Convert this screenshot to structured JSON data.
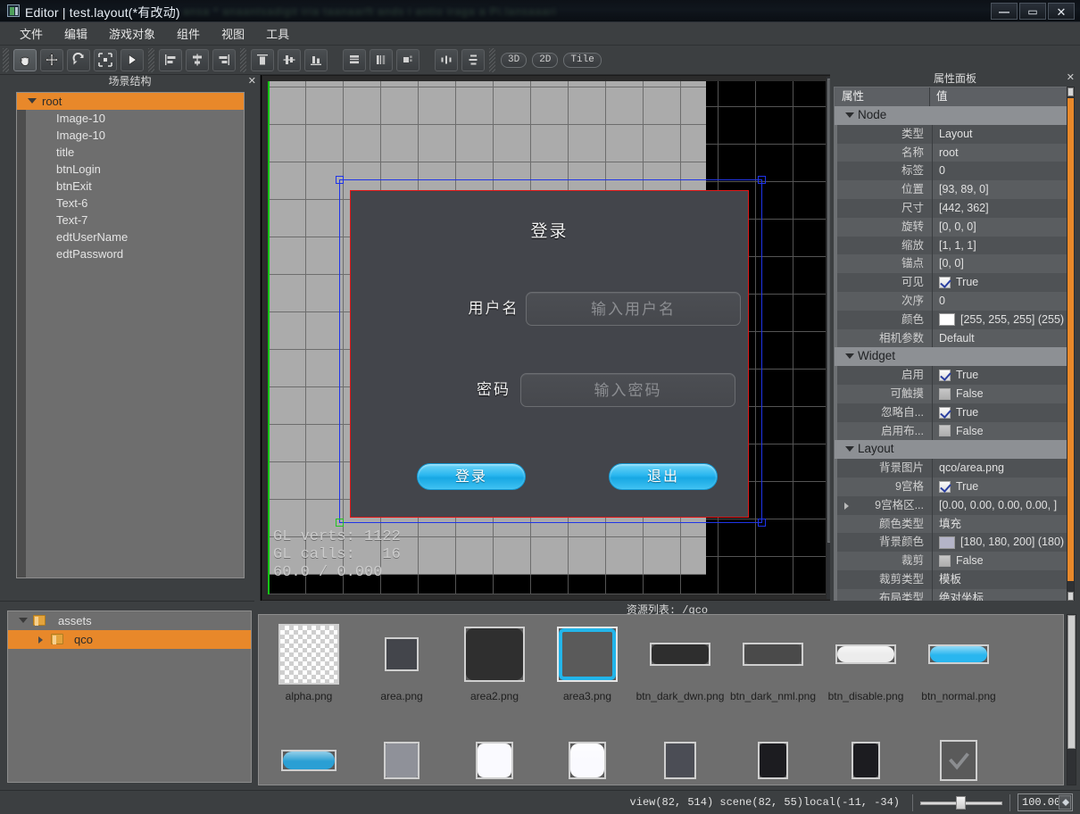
{
  "window": {
    "title": "Editor | test.layout(*有改动)",
    "ghost_title": "ansa  *  anaantsadigit  iria  taanaarft    ands  i  antio  iraga   a   Pi.lansaaari",
    "minimize_label": "—",
    "maximize_label": "▭",
    "close_label": "✕"
  },
  "menubar": {
    "items": [
      {
        "label": "文件"
      },
      {
        "label": "编辑"
      },
      {
        "label": "游戏对象"
      },
      {
        "label": "组件"
      },
      {
        "label": "视图"
      },
      {
        "label": "工具"
      }
    ]
  },
  "toolbar": {
    "tools": [
      {
        "name": "hand-tool",
        "icon": "hand-icon",
        "active": true
      },
      {
        "name": "move-tool",
        "icon": "move-arrows-icon",
        "active": false
      },
      {
        "name": "rotate-tool",
        "icon": "rotate-icon",
        "active": false
      },
      {
        "name": "scale-tool",
        "icon": "scale-icon",
        "active": false
      },
      {
        "name": "play-tool",
        "icon": "play-icon",
        "active": false
      }
    ],
    "align_h": [
      {
        "name": "align-left",
        "icon": "align-left-icon"
      },
      {
        "name": "align-center-h",
        "icon": "align-center-h-icon"
      },
      {
        "name": "align-right",
        "icon": "align-right-icon"
      }
    ],
    "align_v": [
      {
        "name": "align-top",
        "icon": "align-top-icon"
      },
      {
        "name": "align-middle-v",
        "icon": "align-middle-v-icon"
      },
      {
        "name": "align-bottom",
        "icon": "align-bottom-icon"
      }
    ],
    "distribute": [
      {
        "name": "stack-vertical",
        "icon": "stack-vertical-icon"
      },
      {
        "name": "stack-horizontal",
        "icon": "stack-horizontal-icon"
      },
      {
        "name": "size-match",
        "icon": "size-match-icon"
      }
    ],
    "spacing": [
      {
        "name": "distribute-horizontal",
        "icon": "distribute-h-icon"
      },
      {
        "name": "distribute-vertical",
        "icon": "distribute-v-icon"
      }
    ],
    "modes": [
      {
        "label": "3D",
        "name": "mode-3d"
      },
      {
        "label": "2D",
        "name": "mode-2d"
      },
      {
        "label": "Tile",
        "name": "mode-tile"
      }
    ]
  },
  "scene_panel": {
    "title": "场景结构",
    "close_label": "✕",
    "root": {
      "label": "root",
      "selected": true
    },
    "children": [
      {
        "label": "Image-10"
      },
      {
        "label": "Image-10"
      },
      {
        "label": "title"
      },
      {
        "label": "btnLogin"
      },
      {
        "label": "btnExit"
      },
      {
        "label": "Text-6"
      },
      {
        "label": "Text-7"
      },
      {
        "label": "edtUserName"
      },
      {
        "label": "edtPassword"
      }
    ]
  },
  "viewport": {
    "dialog": {
      "title": "登录",
      "fields": [
        {
          "label": "用户名",
          "placeholder": "输入用户名",
          "name": "username"
        },
        {
          "label": "密码",
          "placeholder": "输入密码",
          "name": "password"
        }
      ],
      "buttons": [
        {
          "label": "登录",
          "name": "login"
        },
        {
          "label": "退出",
          "name": "exit"
        }
      ]
    },
    "gl_stats": {
      "verts_label": "GL verts:",
      "verts_value": "1122",
      "calls_label": "GL calls:",
      "calls_value": "16",
      "fps_line": "60.0 / 0.000"
    }
  },
  "properties": {
    "title": "属性面板",
    "close_label": "✕",
    "col_key": "属性",
    "col_value": "值",
    "groups": [
      {
        "name": "Node",
        "rows": [
          {
            "key": "类型",
            "value": "Layout",
            "type": "text"
          },
          {
            "key": "名称",
            "value": "root",
            "type": "text"
          },
          {
            "key": "标签",
            "value": "0",
            "type": "text"
          },
          {
            "key": "位置",
            "value": "[93, 89, 0]",
            "type": "text"
          },
          {
            "key": "尺寸",
            "value": "[442, 362]",
            "type": "text"
          },
          {
            "key": "旋转",
            "value": "[0, 0, 0]",
            "type": "text"
          },
          {
            "key": "缩放",
            "value": "[1, 1, 1]",
            "type": "text"
          },
          {
            "key": "锚点",
            "value": "[0, 0]",
            "type": "text"
          },
          {
            "key": "可见",
            "value": "True",
            "type": "checkbox",
            "checked": true
          },
          {
            "key": "次序",
            "value": "0",
            "type": "text"
          },
          {
            "key": "颜色",
            "value": "[255, 255, 255] (255)",
            "type": "color",
            "color": "#ffffff"
          },
          {
            "key": "相机参数",
            "value": "Default",
            "type": "text"
          }
        ]
      },
      {
        "name": "Widget",
        "rows": [
          {
            "key": "启用",
            "value": "True",
            "type": "checkbox",
            "checked": true
          },
          {
            "key": "可触摸",
            "value": "False",
            "type": "checkbox",
            "checked": false
          },
          {
            "key": "忽略自...",
            "value": "True",
            "type": "checkbox",
            "checked": true
          },
          {
            "key": "启用布...",
            "value": "False",
            "type": "checkbox",
            "checked": false
          }
        ]
      },
      {
        "name": "Layout",
        "rows": [
          {
            "key": "背景图片",
            "value": "qco/area.png",
            "type": "text"
          },
          {
            "key": "9宫格",
            "value": "True",
            "type": "checkbox",
            "checked": true
          },
          {
            "key": "9宫格区...",
            "value": "[0.00, 0.00, 0.00, 0.00, ]",
            "type": "expandable"
          },
          {
            "key": "颜色类型",
            "value": "填充",
            "type": "text"
          },
          {
            "key": "背景颜色",
            "value": "[180, 180, 200] (180)",
            "type": "color",
            "color": "#b4b4c8"
          },
          {
            "key": "裁剪",
            "value": "False",
            "type": "checkbox",
            "checked": false
          },
          {
            "key": "裁剪类型",
            "value": "模板",
            "type": "text"
          },
          {
            "key": "布局类型",
            "value": "绝对坐标",
            "type": "text"
          }
        ]
      }
    ]
  },
  "assets_tree": {
    "root": {
      "label": "assets"
    },
    "children": [
      {
        "label": "qco",
        "selected": true
      }
    ]
  },
  "resources": {
    "title": "资源列表: /qco",
    "items": [
      {
        "name": "alpha.png",
        "thumb": "checker",
        "w": 68,
        "h": 68,
        "color": "#ffffff",
        "radius": 0,
        "selected": false
      },
      {
        "name": "area.png",
        "thumb": "solid",
        "w": 38,
        "h": 38,
        "color": "#43454b",
        "radius": 0,
        "selected": false
      },
      {
        "name": "area2.png",
        "thumb": "solid",
        "w": 68,
        "h": 62,
        "color": "#2f2f2f",
        "radius": 8,
        "selected": false
      },
      {
        "name": "area3.png",
        "thumb": "outline",
        "w": 68,
        "h": 62,
        "color": "#22b5ea",
        "radius": 6,
        "selected": true
      },
      {
        "name": "btn_dark_dwn.png",
        "thumb": "solid",
        "w": 68,
        "h": 26,
        "color": "#2e2e2e",
        "radius": 6,
        "selected": false
      },
      {
        "name": "btn_dark_nml.png",
        "thumb": "solid",
        "w": 68,
        "h": 26,
        "color": "#4a4a4a",
        "radius": 6,
        "selected": false
      },
      {
        "name": "btn_disable.png",
        "thumb": "solid",
        "w": 68,
        "h": 22,
        "color": "#ececec",
        "radius": 11,
        "selected": false
      },
      {
        "name": "btn_normal.png",
        "thumb": "solid",
        "w": 68,
        "h": 22,
        "color": "#29b6ef",
        "radius": 11,
        "selected": false
      },
      {
        "name": "",
        "thumb": "solid",
        "w": 62,
        "h": 24,
        "color": "#2a9fd4",
        "radius": 12,
        "selected": false
      },
      {
        "name": "",
        "thumb": "solid",
        "w": 40,
        "h": 42,
        "color": "#8f9199",
        "radius": 2,
        "selected": false
      },
      {
        "name": "",
        "thumb": "solid",
        "w": 42,
        "h": 42,
        "color": "#fafaff",
        "radius": 7,
        "selected": false
      },
      {
        "name": "",
        "thumb": "solid",
        "w": 42,
        "h": 42,
        "color": "#fafaff",
        "radius": 9,
        "selected": false
      },
      {
        "name": "",
        "thumb": "solid",
        "w": 36,
        "h": 42,
        "color": "#4b4d55",
        "radius": 4,
        "selected": false
      },
      {
        "name": "",
        "thumb": "solid",
        "w": 34,
        "h": 42,
        "color": "#1c1c20",
        "radius": 4,
        "selected": false
      },
      {
        "name": "",
        "thumb": "solid",
        "w": 32,
        "h": 42,
        "color": "#1c1c20",
        "radius": 4,
        "selected": false
      },
      {
        "name": "",
        "thumb": "check",
        "w": 42,
        "h": 46,
        "color": "#8b8d90",
        "radius": 0,
        "selected": false
      }
    ]
  },
  "statusbar": {
    "coords": "view(82, 514) scene(82, 55)local(-11, -34)",
    "zoom_value": "100.00"
  }
}
